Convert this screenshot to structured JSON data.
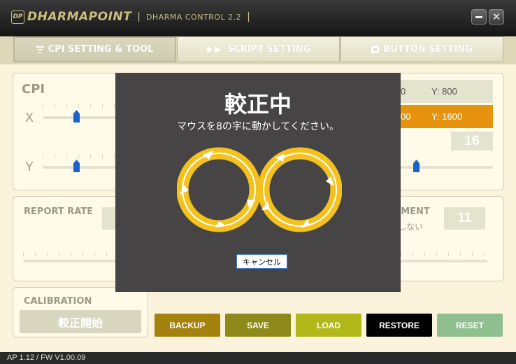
{
  "titlebar": {
    "logo_mark": "DP",
    "logo_text": "DHARMAPOINT",
    "app_name": "DHARMA CONTROL 2.2",
    "separator": "|"
  },
  "tabs": [
    {
      "label": "CPI SETTING & TOOL",
      "icon": "sliders-icon",
      "active": true
    },
    {
      "label": "SCRIPT SETTING",
      "icon": "play-icon",
      "active": false
    },
    {
      "label": "BUTTON SETTING",
      "icon": "button-icon",
      "active": false
    }
  ],
  "cpi": {
    "title": "CPI",
    "x_label": "X",
    "y_label": "Y",
    "row1": {
      "x_partial": "0",
      "y_text": "Y:  800"
    },
    "row2": {
      "x_partial": "00",
      "y_text": "Y:  1600"
    },
    "value": "16"
  },
  "report_rate": {
    "title": "REPORT RATE"
  },
  "adjustment": {
    "title_partial": "STMENT",
    "sub_partial": "調しない",
    "value": "11"
  },
  "calibration": {
    "title": "CALIBRATION",
    "button": "較正開始"
  },
  "actions": [
    {
      "label": "BACKUP",
      "color": "#a4820d",
      "text": "#ffffff"
    },
    {
      "label": "SAVE",
      "color": "#8d8a19",
      "text": "#ffffff"
    },
    {
      "label": "LOAD",
      "color": "#b2b81a",
      "text": "#ffffff"
    },
    {
      "label": "RESTORE",
      "color": "#000000",
      "text": "#ffffff"
    },
    {
      "label": "RESET",
      "color": "#8fbe8f",
      "text": "#ffffff"
    }
  ],
  "status": "AP 1.12 / FW V1.00.09",
  "modal": {
    "title": "較正中",
    "subtitle": "マウスを8の字に動かしてください。",
    "cancel": "キャンセル",
    "figure_icon": "figure-eight-arrows-icon"
  },
  "colors": {
    "accent_orange": "#e6930d",
    "figure_yellow": "#f4c21f",
    "modal_bg": "#464444"
  }
}
